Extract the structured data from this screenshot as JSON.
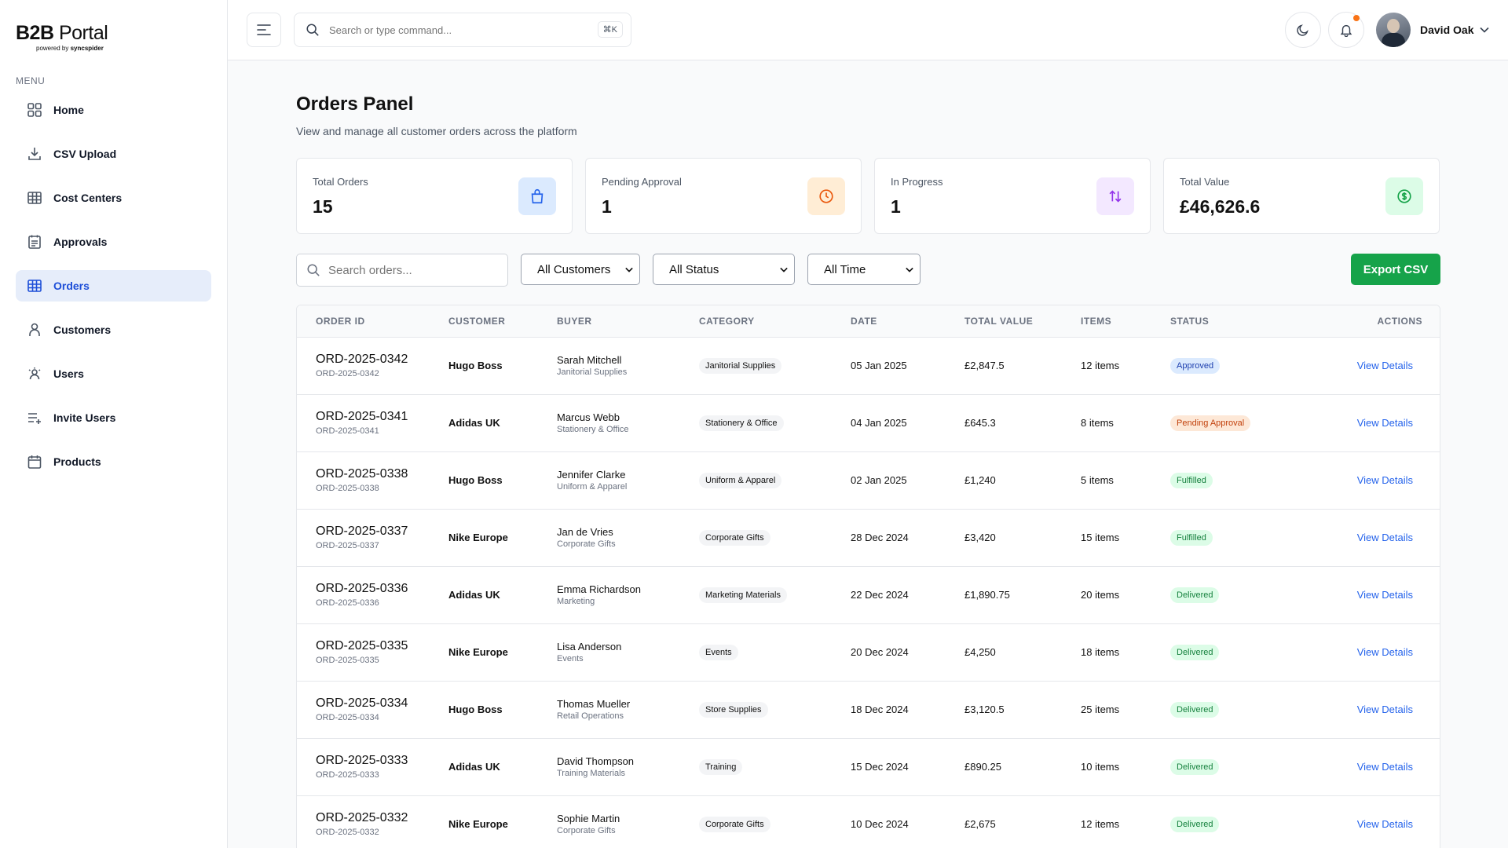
{
  "brand": {
    "title_bold": "B2B",
    "title_light": "Portal",
    "powered_by": "powered by",
    "powered_brand": "syncspider"
  },
  "sidebar": {
    "menu_label": "MENU",
    "items": [
      {
        "label": "Home",
        "icon": "grid-icon"
      },
      {
        "label": "CSV Upload",
        "icon": "download-icon"
      },
      {
        "label": "Cost Centers",
        "icon": "table-icon"
      },
      {
        "label": "Approvals",
        "icon": "checklist-icon"
      },
      {
        "label": "Orders",
        "icon": "table-icon",
        "active": true
      },
      {
        "label": "Customers",
        "icon": "person-icon"
      },
      {
        "label": "Users",
        "icon": "users-icon"
      },
      {
        "label": "Invite Users",
        "icon": "add-list-icon"
      },
      {
        "label": "Products",
        "icon": "calendar-icon"
      }
    ]
  },
  "topbar": {
    "search_placeholder": "Search or type command...",
    "shortcut": "⌘K",
    "user_name": "David Oak"
  },
  "page": {
    "title": "Orders Panel",
    "subtitle": "View and manage all customer orders across the platform"
  },
  "stats": [
    {
      "label": "Total Orders",
      "value": "15",
      "icon": "bag-icon",
      "color": "#2563eb",
      "bg": "#dbeafe"
    },
    {
      "label": "Pending Approval",
      "value": "1",
      "icon": "clock-icon",
      "color": "#ea580c",
      "bg": "#ffedd5"
    },
    {
      "label": "In Progress",
      "value": "1",
      "icon": "arrows-updown-icon",
      "color": "#9333ea",
      "bg": "#f3e8ff"
    },
    {
      "label": "Total Value",
      "value": "£46,626.6",
      "icon": "dollar-icon",
      "color": "#16a34a",
      "bg": "#dcfce7"
    }
  ],
  "filters": {
    "search_placeholder": "Search orders...",
    "customers": "All Customers",
    "status": "All Status",
    "time": "All Time",
    "export_label": "Export CSV"
  },
  "table": {
    "headers": [
      "ORDER ID",
      "CUSTOMER",
      "BUYER",
      "CATEGORY",
      "DATE",
      "TOTAL VALUE",
      "ITEMS",
      "STATUS",
      "ACTIONS"
    ],
    "rows": [
      {
        "id": "ORD-2025-0342",
        "id_sub": "ORD-2025-0342",
        "customer": "Hugo Boss",
        "buyer": "Sarah Mitchell",
        "buyer_sub": "Janitorial Supplies",
        "category": "Janitorial Supplies",
        "date": "05 Jan 2025",
        "total": "£2,847.5",
        "items": "12 items",
        "status": "Approved",
        "status_type": "approved",
        "action": "View Details"
      },
      {
        "id": "ORD-2025-0341",
        "id_sub": "ORD-2025-0341",
        "customer": "Adidas UK",
        "buyer": "Marcus Webb",
        "buyer_sub": "Stationery & Office",
        "category": "Stationery & Office",
        "date": "04 Jan 2025",
        "total": "£645.3",
        "items": "8 items",
        "status": "Pending Approval",
        "status_type": "pending",
        "action": "View Details"
      },
      {
        "id": "ORD-2025-0338",
        "id_sub": "ORD-2025-0338",
        "customer": "Hugo Boss",
        "buyer": "Jennifer Clarke",
        "buyer_sub": "Uniform & Apparel",
        "category": "Uniform & Apparel",
        "date": "02 Jan 2025",
        "total": "£1,240",
        "items": "5 items",
        "status": "Fulfilled",
        "status_type": "fulfilled",
        "action": "View Details"
      },
      {
        "id": "ORD-2025-0337",
        "id_sub": "ORD-2025-0337",
        "customer": "Nike Europe",
        "buyer": "Jan de Vries",
        "buyer_sub": "Corporate Gifts",
        "category": "Corporate Gifts",
        "date": "28 Dec 2024",
        "total": "£3,420",
        "items": "15 items",
        "status": "Fulfilled",
        "status_type": "fulfilled",
        "action": "View Details"
      },
      {
        "id": "ORD-2025-0336",
        "id_sub": "ORD-2025-0336",
        "customer": "Adidas UK",
        "buyer": "Emma Richardson",
        "buyer_sub": "Marketing",
        "category": "Marketing Materials",
        "date": "22 Dec 2024",
        "total": "£1,890.75",
        "items": "20 items",
        "status": "Delivered",
        "status_type": "delivered",
        "action": "View Details"
      },
      {
        "id": "ORD-2025-0335",
        "id_sub": "ORD-2025-0335",
        "customer": "Nike Europe",
        "buyer": "Lisa Anderson",
        "buyer_sub": "Events",
        "category": "Events",
        "date": "20 Dec 2024",
        "total": "£4,250",
        "items": "18 items",
        "status": "Delivered",
        "status_type": "delivered",
        "action": "View Details"
      },
      {
        "id": "ORD-2025-0334",
        "id_sub": "ORD-2025-0334",
        "customer": "Hugo Boss",
        "buyer": "Thomas Mueller",
        "buyer_sub": "Retail Operations",
        "category": "Store Supplies",
        "date": "18 Dec 2024",
        "total": "£3,120.5",
        "items": "25 items",
        "status": "Delivered",
        "status_type": "delivered",
        "action": "View Details"
      },
      {
        "id": "ORD-2025-0333",
        "id_sub": "ORD-2025-0333",
        "customer": "Adidas UK",
        "buyer": "David Thompson",
        "buyer_sub": "Training Materials",
        "category": "Training",
        "date": "15 Dec 2024",
        "total": "£890.25",
        "items": "10 items",
        "status": "Delivered",
        "status_type": "delivered",
        "action": "View Details"
      },
      {
        "id": "ORD-2025-0332",
        "id_sub": "ORD-2025-0332",
        "customer": "Nike Europe",
        "buyer": "Sophie Martin",
        "buyer_sub": "Corporate Gifts",
        "category": "Corporate Gifts",
        "date": "10 Dec 2024",
        "total": "£2,675",
        "items": "12 items",
        "status": "Delivered",
        "status_type": "delivered",
        "action": "View Details"
      }
    ]
  }
}
